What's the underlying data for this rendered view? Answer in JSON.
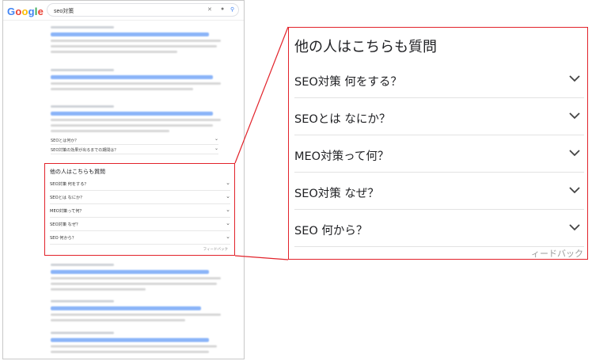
{
  "serp": {
    "logo": [
      {
        "ch": "G",
        "color": "#4285F4"
      },
      {
        "ch": "o",
        "color": "#EA4335"
      },
      {
        "ch": "o",
        "color": "#FBBC05"
      },
      {
        "ch": "g",
        "color": "#4285F4"
      },
      {
        "ch": "l",
        "color": "#34A853"
      },
      {
        "ch": "e",
        "color": "#EA4335"
      }
    ],
    "query": "seo対策",
    "mini_questions": [
      "SEOとは何か？",
      "SEO対策の効果が出るまでの期間は？"
    ],
    "paa_title": "他の人はこちらも質問",
    "paa_questions": [
      "SEO対策 何をする？",
      "SEOとは なにか？",
      "MEO対策って何？",
      "SEO対策 なぜ？",
      "SEO 何から？"
    ],
    "paa_feedback": "フィードバック"
  },
  "zoom": {
    "title": "他の人はこちらも質問",
    "questions": [
      "SEO対策 何をする？",
      "SEOとは なにか？",
      "MEO対策って何？",
      "SEO対策 なぜ？",
      "SEO 何から？"
    ],
    "feedback": "ィードバック"
  },
  "colors": {
    "highlight": "#e2222a",
    "link": "#1a0dab"
  }
}
